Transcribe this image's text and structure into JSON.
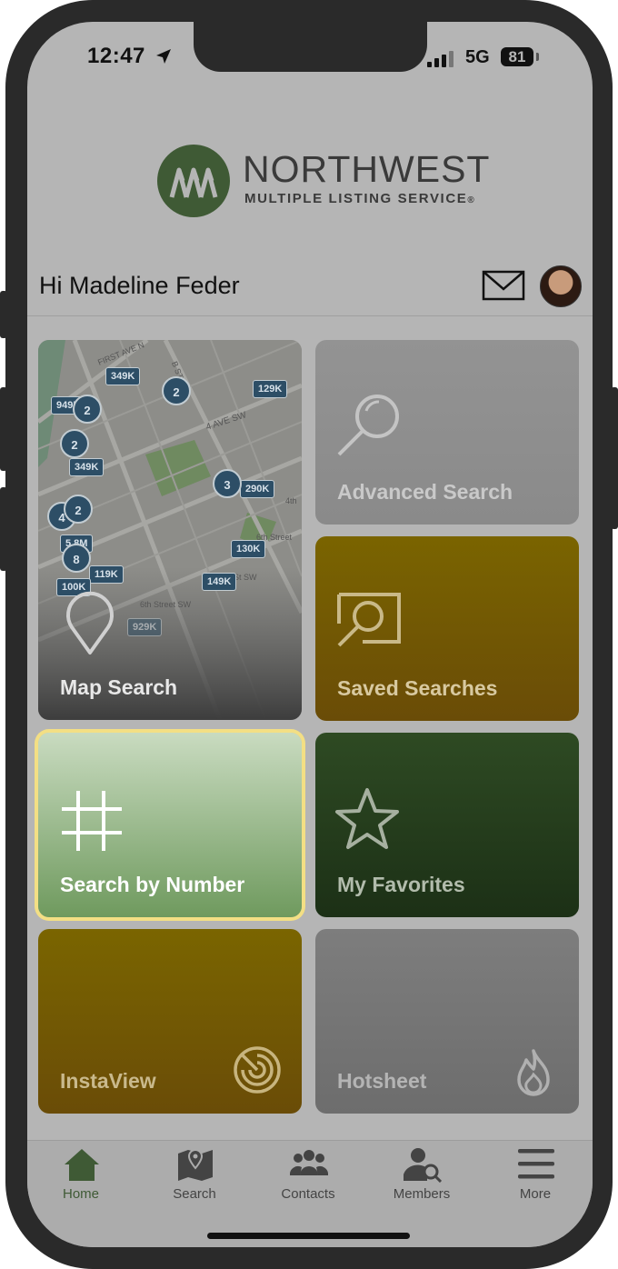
{
  "status_bar": {
    "time": "12:47",
    "network": "5G",
    "battery": "81",
    "icons": [
      "location-arrow-icon",
      "signal-icon",
      "battery-icon"
    ]
  },
  "brand": {
    "title": "NORTHWEST",
    "subtitle": "MULTIPLE LISTING SERVICE",
    "registered": "®",
    "color": "#3f5a35"
  },
  "header": {
    "greeting": "Hi Madeline Feder",
    "icons": [
      "mail-icon",
      "avatar"
    ]
  },
  "tiles": {
    "map_search": {
      "label": "Map Search",
      "icon": "map-pin-icon",
      "clusters": [
        "2",
        "2",
        "2",
        "4",
        "2",
        "3",
        "8"
      ],
      "prices": [
        "349K",
        "129K",
        "949K",
        "349K",
        "290K",
        "5.8M",
        "119K",
        "130K",
        "100K",
        "149K",
        "929K"
      ],
      "streets": [
        "FIRST AVE N",
        "4 AVE SW",
        "B ST SW",
        "6th Street",
        "6th Street SW",
        "4th",
        "6th St SW"
      ]
    },
    "advanced_search": {
      "label": "Advanced Search",
      "icon": "magnifier-icon"
    },
    "saved_searches": {
      "label": "Saved Searches",
      "icon": "saved-search-icon"
    },
    "search_by_number": {
      "label": "Search by Number",
      "icon": "hash-icon"
    },
    "my_favorites": {
      "label": "My Favorites",
      "icon": "star-icon"
    },
    "instaview": {
      "label": "InstaView",
      "icon": "radar-icon"
    },
    "hotsheet": {
      "label": "Hotsheet",
      "icon": "flame-icon"
    }
  },
  "tabbar": {
    "active_color": "#3f5a35",
    "items": [
      {
        "label": "Home",
        "icon": "home-icon"
      },
      {
        "label": "Search",
        "icon": "map-icon"
      },
      {
        "label": "Contacts",
        "icon": "contacts-icon"
      },
      {
        "label": "Members",
        "icon": "member-search-icon"
      },
      {
        "label": "More",
        "icon": "hamburger-menu-icon"
      }
    ]
  }
}
